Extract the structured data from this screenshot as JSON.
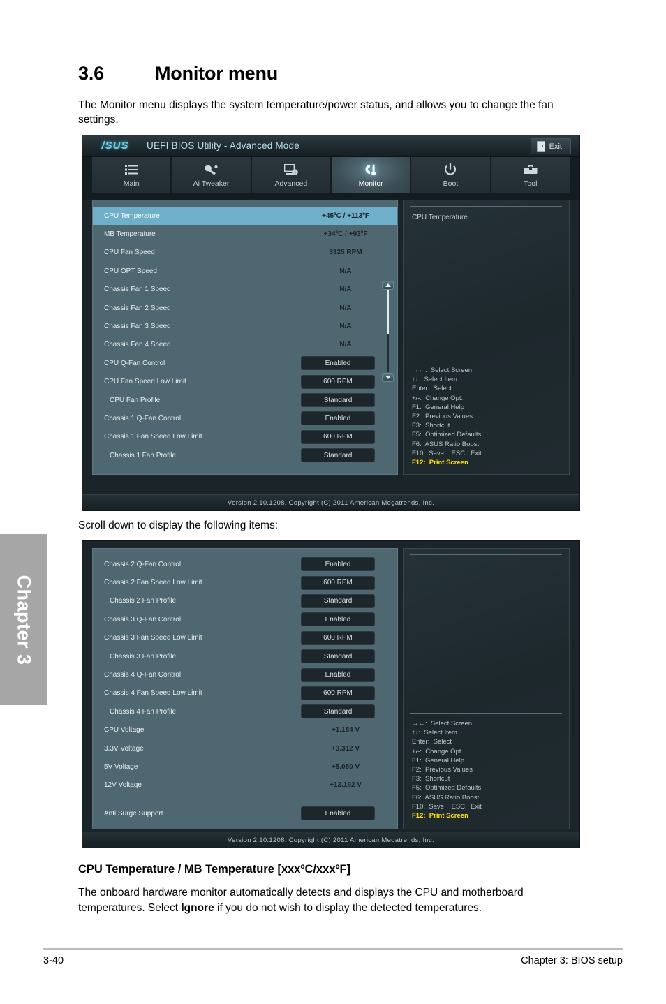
{
  "page": {
    "section_number": "3.6",
    "section_title": "Monitor menu",
    "intro": "The Monitor menu displays the system temperature/power status, and allows you to change the fan settings.",
    "scroll_note": "Scroll down to display the following items:",
    "subheading": "CPU Temperature / MB Temperature [xxxºC/xxxºF]",
    "body_para_1": "The onboard hardware monitor automatically detects and displays the CPU and motherboard",
    "body_para_2_a": "temperatures. Select ",
    "body_para_2_b": "Ignore",
    "body_para_2_c": " if you do not wish to display the detected temperatures.",
    "chapter_tab": "Chapter 3",
    "footer_left": "3-40",
    "footer_right": "Chapter 3: BIOS setup"
  },
  "bios": {
    "brand": "/SUS",
    "title": "UEFI BIOS Utility - Advanced Mode",
    "exit_label": "Exit",
    "tabs": [
      {
        "label": "Main",
        "icon": "list-icon",
        "active": false
      },
      {
        "label": "Ai  Tweaker",
        "icon": "tweak-icon",
        "active": false
      },
      {
        "label": "Advanced",
        "icon": "monitor-info-icon",
        "active": false
      },
      {
        "label": "Monitor",
        "icon": "thermometer-icon",
        "active": true
      },
      {
        "label": "Boot",
        "icon": "power-icon",
        "active": false
      },
      {
        "label": "Tool",
        "icon": "toolbox-icon",
        "active": false
      }
    ],
    "version_text": "Version  2.10.1208.    Copyright  (C)  2011  American  Megatrends,  Inc.",
    "help_title": "CPU Temperature",
    "help_keys": [
      {
        "text": "→←:  Select Screen",
        "accent": false
      },
      {
        "text": "↑↓:  Select Item",
        "accent": false
      },
      {
        "text": "Enter:  Select",
        "accent": false
      },
      {
        "text": "+/-:  Change Opt.",
        "accent": false
      },
      {
        "text": "F1:  General Help",
        "accent": false
      },
      {
        "text": "F2:  Previous Values",
        "accent": false
      },
      {
        "text": "F3:  Shortcut",
        "accent": false
      },
      {
        "text": "F5:  Optimized Defaults",
        "accent": false
      },
      {
        "text": "F6:  ASUS Ratio Boost",
        "accent": false
      },
      {
        "text": "F10:  Save    ESC:  Exit",
        "accent": false
      },
      {
        "text": "F12:  Print Screen",
        "accent": true
      }
    ],
    "screen1_rows": [
      {
        "label": "CPU Temperature",
        "value": "+45ºC / +113ºF",
        "type": "value",
        "selected": true,
        "indent": false
      },
      {
        "label": "MB Temperature",
        "value": "+34ºC / +93ºF",
        "type": "value",
        "selected": false,
        "indent": false
      },
      {
        "label": "CPU Fan Speed",
        "value": "3325 RPM",
        "type": "value",
        "selected": false,
        "indent": false
      },
      {
        "label": "CPU OPT Speed",
        "value": "N/A",
        "type": "value",
        "selected": false,
        "indent": false
      },
      {
        "label": "Chassis Fan 1 Speed",
        "value": "N/A",
        "type": "value",
        "selected": false,
        "indent": false
      },
      {
        "label": "Chassis Fan 2 Speed",
        "value": "N/A",
        "type": "value",
        "selected": false,
        "indent": false
      },
      {
        "label": "Chassis Fan 3 Speed",
        "value": "N/A",
        "type": "value",
        "selected": false,
        "indent": false
      },
      {
        "label": "Chassis Fan 4 Speed",
        "value": "N/A",
        "type": "value",
        "selected": false,
        "indent": false
      },
      {
        "label": "CPU Q-Fan Control",
        "value": "Enabled",
        "type": "option",
        "selected": false,
        "indent": false
      },
      {
        "label": "CPU Fan Speed Low Limit",
        "value": "600 RPM",
        "type": "option",
        "selected": false,
        "indent": false
      },
      {
        "label": "CPU Fan Profile",
        "value": "Standard",
        "type": "option",
        "selected": false,
        "indent": true
      },
      {
        "label": "Chassis 1 Q-Fan Control",
        "value": "Enabled",
        "type": "option",
        "selected": false,
        "indent": false
      },
      {
        "label": "Chassis 1 Fan Speed Low Limit",
        "value": "600 RPM",
        "type": "option",
        "selected": false,
        "indent": false
      },
      {
        "label": "Chassis 1 Fan Profile",
        "value": "Standard",
        "type": "option",
        "selected": false,
        "indent": true
      }
    ],
    "screen2_rows": [
      {
        "label": "Chassis 2 Q-Fan Control",
        "value": "Enabled",
        "type": "option",
        "selected": false,
        "indent": false
      },
      {
        "label": "Chassis 2 Fan Speed Low Limit",
        "value": "600 RPM",
        "type": "option",
        "selected": false,
        "indent": false
      },
      {
        "label": "Chassis 2 Fan Profile",
        "value": "Standard",
        "type": "option",
        "selected": false,
        "indent": true
      },
      {
        "label": "Chassis 3 Q-Fan Control",
        "value": "Enabled",
        "type": "option",
        "selected": false,
        "indent": false
      },
      {
        "label": "Chassis 3 Fan Speed Low Limit",
        "value": "600 RPM",
        "type": "option",
        "selected": false,
        "indent": false
      },
      {
        "label": "Chassis 3 Fan Profile",
        "value": "Standard",
        "type": "option",
        "selected": false,
        "indent": true
      },
      {
        "label": "Chassis 4 Q-Fan Control",
        "value": "Enabled",
        "type": "option",
        "selected": false,
        "indent": false
      },
      {
        "label": "Chassis 4 Fan Speed Low Limit",
        "value": "600 RPM",
        "type": "option",
        "selected": false,
        "indent": false
      },
      {
        "label": "Chassis 4 Fan Profile",
        "value": "Standard",
        "type": "option",
        "selected": false,
        "indent": true
      },
      {
        "label": "CPU Voltage",
        "value": "+1.184 V",
        "type": "value",
        "selected": false,
        "indent": false
      },
      {
        "label": "3.3V Voltage",
        "value": "+3.312 V",
        "type": "value",
        "selected": false,
        "indent": false
      },
      {
        "label": "5V Voltage",
        "value": "+5.080 V",
        "type": "value",
        "selected": false,
        "indent": false
      },
      {
        "label": "12V Voltage",
        "value": "+12.192 V",
        "type": "value",
        "selected": false,
        "indent": false
      },
      {
        "label": "__SPACER__",
        "value": "",
        "type": "spacer",
        "selected": false,
        "indent": false
      },
      {
        "label": "Anti Surge Support",
        "value": "Enabled",
        "type": "option",
        "selected": false,
        "indent": false
      }
    ]
  },
  "colors": {
    "accent_cyan": "#6fd4e8",
    "selected_row": "#6fafc9",
    "pane_bg": "#4e6770",
    "highlight_yellow": "#ffe000"
  }
}
